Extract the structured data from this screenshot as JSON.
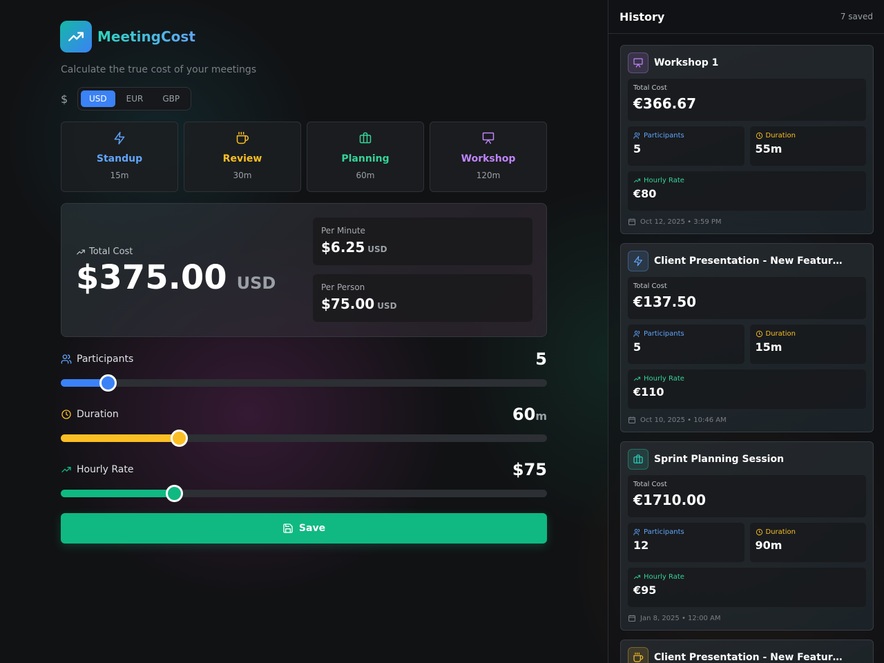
{
  "app": {
    "name": "MeetingCost",
    "subtitle": "Calculate the true cost of your meetings",
    "currency_symbol": "$"
  },
  "currency": {
    "options": [
      "USD",
      "EUR",
      "GBP"
    ],
    "selected": "USD"
  },
  "presets": [
    {
      "name": "Standup",
      "duration": "15m",
      "icon": "lightning-icon",
      "color": "#60a5fa"
    },
    {
      "name": "Review",
      "duration": "30m",
      "icon": "coffee-icon",
      "color": "#fbbf24"
    },
    {
      "name": "Planning",
      "duration": "60m",
      "icon": "briefcase-icon",
      "color": "#34d399"
    },
    {
      "name": "Workshop",
      "duration": "120m",
      "icon": "presentation-icon",
      "color": "#c084fc"
    }
  ],
  "summary": {
    "total_label": "Total Cost",
    "total_value": "$375.00",
    "total_currency": "USD",
    "per_minute_label": "Per Minute",
    "per_minute_value": "$6.25",
    "per_minute_currency": "USD",
    "per_person_label": "Per Person",
    "per_person_value": "$75.00",
    "per_person_currency": "USD"
  },
  "sliders": {
    "participants": {
      "label": "Participants",
      "value": "5",
      "unit": "",
      "fraction": 0.0966,
      "color": "#3b82f6"
    },
    "duration": {
      "label": "Duration",
      "value": "60",
      "unit": "m",
      "fraction": 0.2429,
      "color": "#fbbf24"
    },
    "rate": {
      "label": "Hourly Rate",
      "value": "$75",
      "unit": "",
      "fraction": 0.233,
      "color": "#10b981"
    }
  },
  "save_label": "Save",
  "history": {
    "title": "History",
    "count": "7 saved",
    "labels": {
      "total": "Total Cost",
      "participants": "Participants",
      "duration": "Duration",
      "rate": "Hourly Rate"
    },
    "items": [
      {
        "title": "Workshop 1",
        "icon": "presentation-icon",
        "accent": "#c084fc",
        "total": "€366.67",
        "participants": "5",
        "duration": "55m",
        "rate": "€80",
        "date": "Oct 12, 2025 • 3:59 PM"
      },
      {
        "title": "Client Presentation - New Feature Demo",
        "icon": "lightning-icon",
        "accent": "#60a5fa",
        "total": "€137.50",
        "participants": "5",
        "duration": "15m",
        "rate": "€110",
        "date": "Oct 10, 2025 • 10:46 AM"
      },
      {
        "title": "Sprint Planning Session",
        "icon": "briefcase-icon",
        "accent": "#2dd4bf",
        "total": "€1710.00",
        "participants": "12",
        "duration": "90m",
        "rate": "€95",
        "date": "Jan 8, 2025 • 12:00 AM"
      },
      {
        "title": "Client Presentation - New Feature Demo",
        "icon": "coffee-icon",
        "accent": "#fbbf24"
      }
    ]
  }
}
